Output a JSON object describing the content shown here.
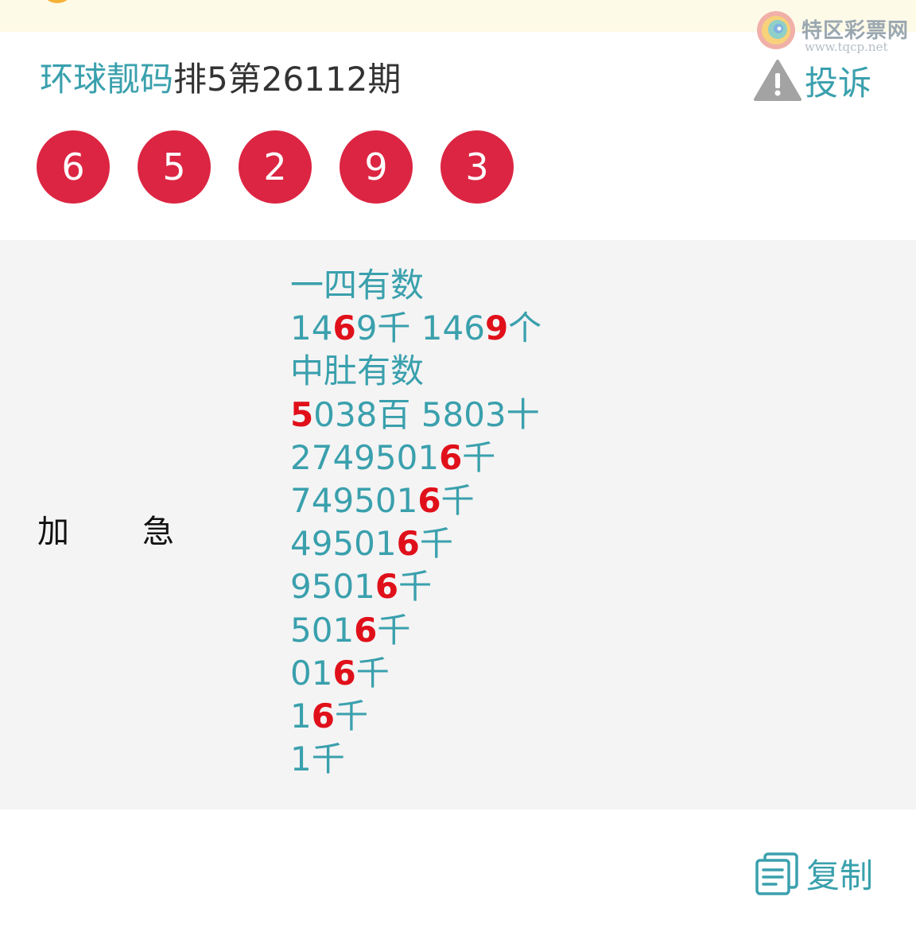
{
  "watermark": {
    "title": "特区彩票网",
    "url": "www.tqcp.net"
  },
  "header": {
    "brand": "环球靓码",
    "issue": "排5第26112期",
    "complain_label": "投诉"
  },
  "colors": {
    "accent": "#3aa0ad",
    "ball": "#dc2542",
    "highlight": "#e0101a",
    "panel_bg": "#f4f4f4"
  },
  "balls": [
    "6",
    "5",
    "2",
    "9",
    "3"
  ],
  "content": {
    "side_label": "加急",
    "lines": [
      [
        {
          "t": "一四有数"
        }
      ],
      [
        {
          "t": "14"
        },
        {
          "t": "6",
          "h": true
        },
        {
          "t": "9千 146"
        },
        {
          "t": "9",
          "h": true
        },
        {
          "t": "个"
        }
      ],
      [
        {
          "t": "中肚有数"
        }
      ],
      [
        {
          "t": "5",
          "h": true
        },
        {
          "t": "038百 5803十"
        }
      ],
      [
        {
          "t": "2749501"
        },
        {
          "t": "6",
          "h": true
        },
        {
          "t": "千"
        }
      ],
      [
        {
          "t": "749501"
        },
        {
          "t": "6",
          "h": true
        },
        {
          "t": "千"
        }
      ],
      [
        {
          "t": "49501"
        },
        {
          "t": "6",
          "h": true
        },
        {
          "t": "千"
        }
      ],
      [
        {
          "t": "9501"
        },
        {
          "t": "6",
          "h": true
        },
        {
          "t": "千"
        }
      ],
      [
        {
          "t": "501"
        },
        {
          "t": "6",
          "h": true
        },
        {
          "t": "千"
        }
      ],
      [
        {
          "t": "01"
        },
        {
          "t": "6",
          "h": true
        },
        {
          "t": "千"
        }
      ],
      [
        {
          "t": "1"
        },
        {
          "t": "6",
          "h": true
        },
        {
          "t": "千"
        }
      ],
      [
        {
          "t": "1千"
        }
      ]
    ]
  },
  "footer": {
    "copy_label": "复制"
  },
  "icons": {
    "logo": "tqcp-logo-icon",
    "complain": "warning-triangle-icon",
    "copy": "copy-document-icon"
  }
}
